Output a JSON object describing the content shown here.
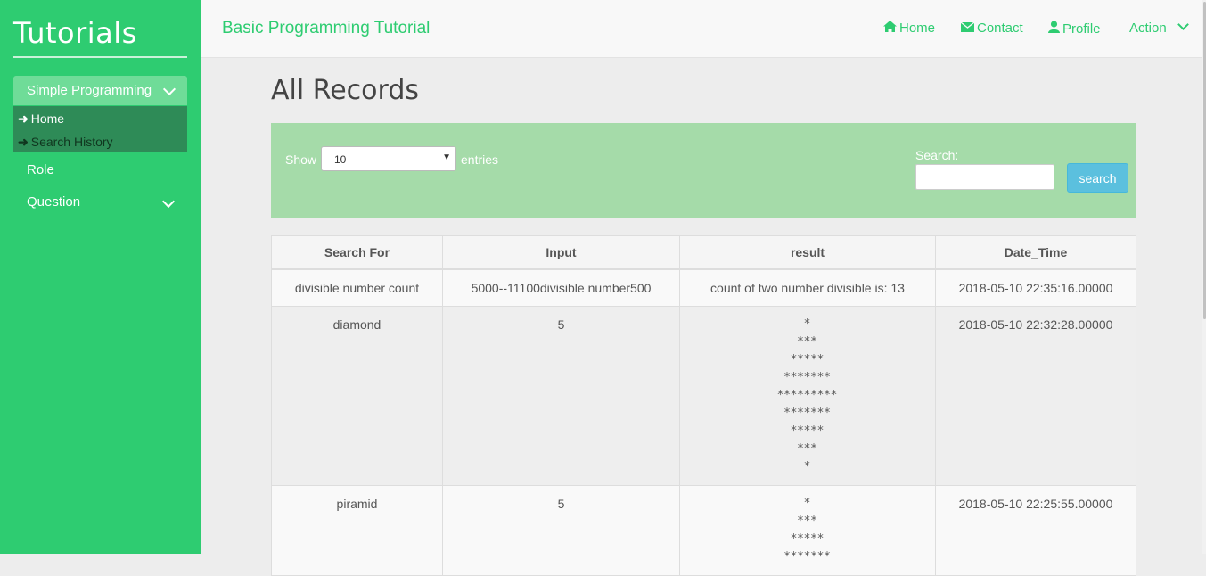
{
  "sidebar": {
    "brand": "Tutorials",
    "active_menu": "Simple Programming",
    "submenu": [
      "Home",
      "Search History"
    ],
    "items": [
      "Role",
      "Question"
    ]
  },
  "topnav": {
    "title": "Basic Programming Tutorial",
    "links": [
      {
        "label": "Home",
        "icon": "home-icon"
      },
      {
        "label": "Contact",
        "icon": "envelope-icon"
      },
      {
        "label": "Profile",
        "icon": "user-icon"
      },
      {
        "label": "Action",
        "icon": "chevron-down-icon"
      }
    ]
  },
  "main": {
    "title": "All Records",
    "filter": {
      "show_label": "Show",
      "entries_value": "10",
      "entries_label": "entries",
      "search_label": "Search:",
      "search_value": "",
      "search_button": "search"
    },
    "table": {
      "headers": [
        "Search For",
        "Input",
        "result",
        "Date_Time"
      ],
      "rows": [
        {
          "search_for": "divisible number count",
          "input": "5000--11100divisible number500",
          "result": "count of two number divisible is: 13",
          "date_time": "2018-05-10 22:35:16.00000"
        },
        {
          "search_for": "diamond",
          "input": "5",
          "result": "*\n***\n*****\n*******\n*********\n*******\n*****\n***\n*",
          "date_time": "2018-05-10 22:32:28.00000"
        },
        {
          "search_for": "piramid",
          "input": "5",
          "result": "*\n***\n*****\n*******",
          "date_time": "2018-05-10 22:25:55.00000"
        }
      ]
    }
  },
  "colors": {
    "sidebar_bg": "#2ecc71",
    "active_menu_bg": "#6fdc98",
    "submenu_bg": "#2e8b57",
    "accent": "#2ecc71",
    "filter_panel_bg": "#a5dba9",
    "search_button_bg": "#5bc0de"
  }
}
